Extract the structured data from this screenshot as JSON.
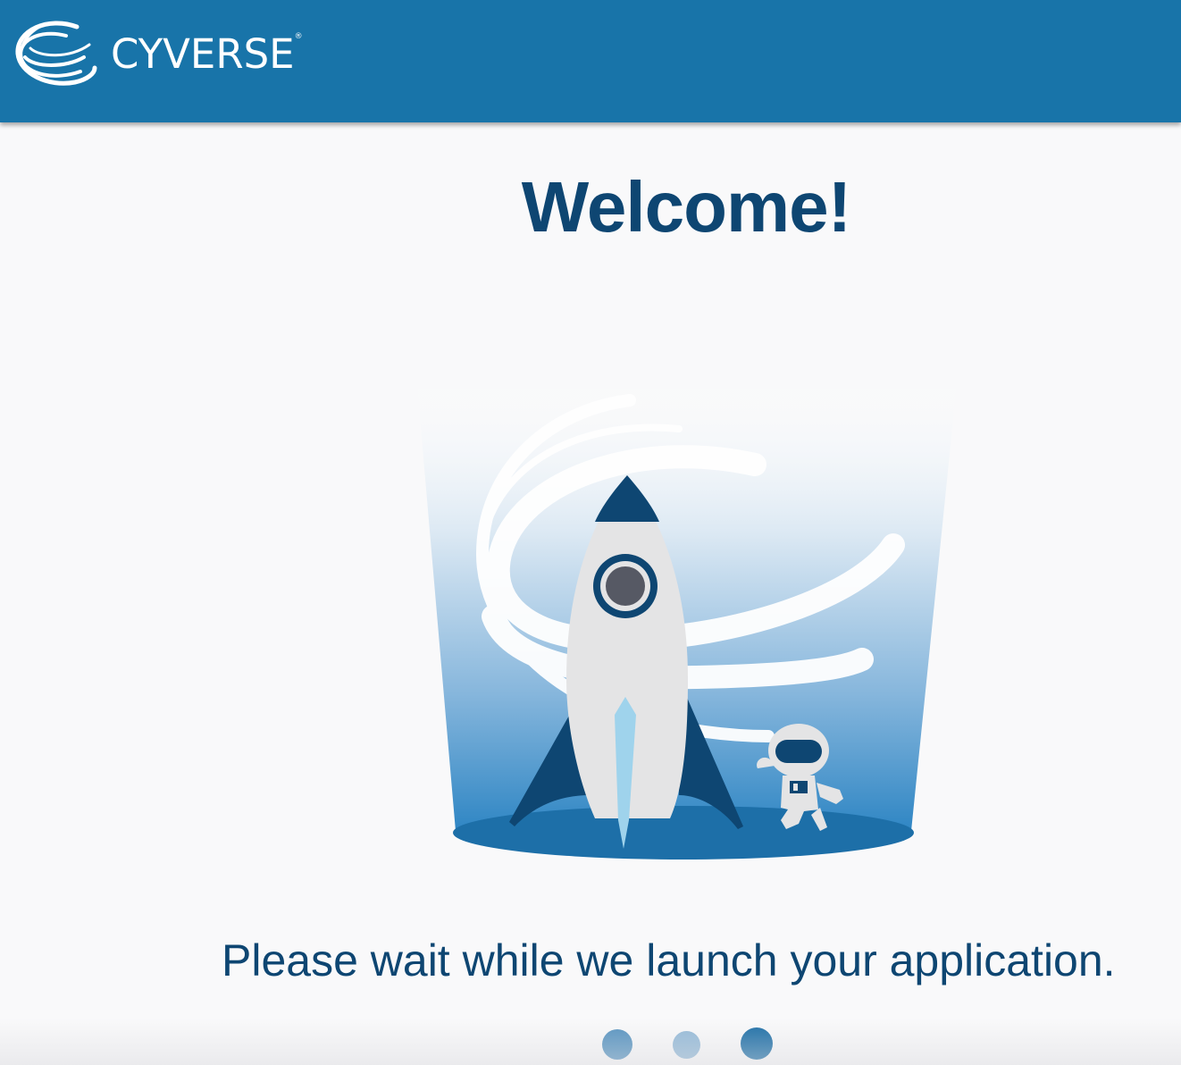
{
  "header": {
    "brand_name": "CYVERSE",
    "brand_mark": "®",
    "logo_icon": "cyverse-swoosh-logo-icon",
    "background_color": "#1874a9"
  },
  "main": {
    "heading": "Welcome!",
    "illustration": "rocket-astronaut-launch-illustration",
    "message": "Please wait while we launch your application."
  },
  "loader": {
    "dots": [
      {
        "name": "loading-dot-1",
        "color": "#5693c0"
      },
      {
        "name": "loading-dot-2",
        "color": "#94bad8"
      },
      {
        "name": "loading-dot-3",
        "color": "#1c6ea6"
      }
    ]
  },
  "colors": {
    "text_primary": "#0e4672",
    "accent": "#1874a9",
    "page_background": "#f9f9fa"
  }
}
